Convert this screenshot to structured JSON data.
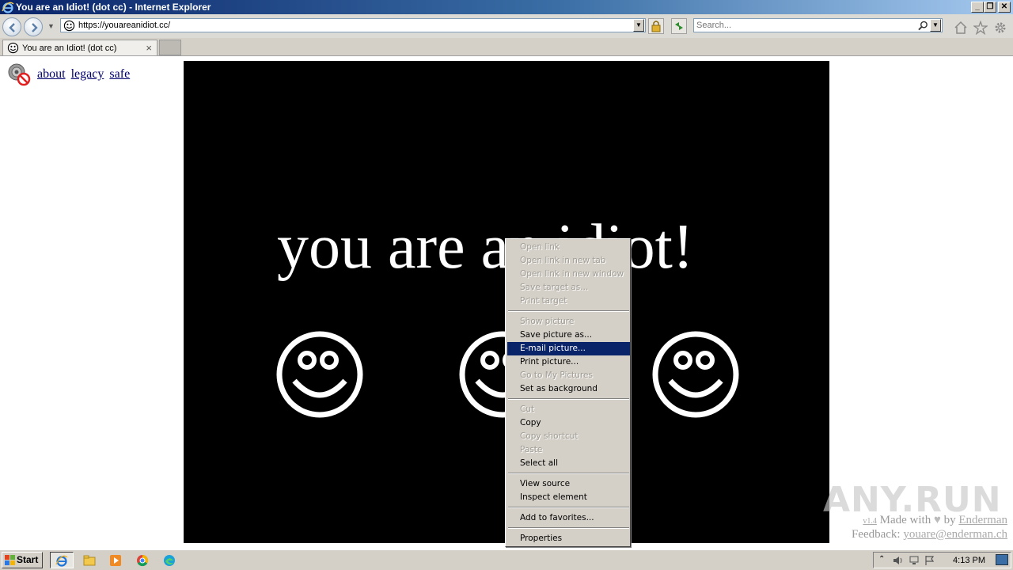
{
  "window": {
    "title": "You are an Idiot! (dot cc) - Internet Explorer",
    "minimize_glyph": "_",
    "restore_glyph": "❐",
    "close_glyph": "✕"
  },
  "navbar": {
    "url": "https://youareanidiot.cc/",
    "search_placeholder": "Search..."
  },
  "tabs": [
    {
      "label": "You are an Idiot! (dot cc)",
      "close_glyph": "×"
    }
  ],
  "page": {
    "links": [
      "about",
      "legacy",
      "safe"
    ],
    "headline": "you are an idiot!",
    "smiley_icon": "smiley-face-icon",
    "credits": {
      "version": "v1.4",
      "made_with": "Made with",
      "by": "by",
      "author": "Enderman",
      "feedback_label": "Feedback:",
      "feedback_email": "youare@enderman.ch"
    },
    "watermark": "ANY.RUN"
  },
  "context_menu": {
    "groups": [
      [
        {
          "label": "Open link",
          "enabled": false
        },
        {
          "label": "Open link in new tab",
          "enabled": false
        },
        {
          "label": "Open link in new window",
          "enabled": false
        },
        {
          "label": "Save target as...",
          "enabled": false
        },
        {
          "label": "Print target",
          "enabled": false
        }
      ],
      [
        {
          "label": "Show picture",
          "enabled": false
        },
        {
          "label": "Save picture as...",
          "enabled": true
        },
        {
          "label": "E-mail picture...",
          "enabled": true,
          "highlighted": true
        },
        {
          "label": "Print picture...",
          "enabled": true
        },
        {
          "label": "Go to My Pictures",
          "enabled": false
        },
        {
          "label": "Set as background",
          "enabled": true
        }
      ],
      [
        {
          "label": "Cut",
          "enabled": false
        },
        {
          "label": "Copy",
          "enabled": true
        },
        {
          "label": "Copy shortcut",
          "enabled": false
        },
        {
          "label": "Paste",
          "enabled": false
        },
        {
          "label": "Select all",
          "enabled": true
        }
      ],
      [
        {
          "label": "View source",
          "enabled": true
        },
        {
          "label": "Inspect element",
          "enabled": true
        }
      ],
      [
        {
          "label": "Add to favorites...",
          "enabled": true
        }
      ],
      [
        {
          "label": "Properties",
          "enabled": true
        }
      ]
    ]
  },
  "taskbar": {
    "start_label": "Start",
    "clock": "4:13 PM",
    "pinned": [
      "internet-explorer-icon",
      "explorer-folder-icon",
      "media-player-icon",
      "chrome-icon",
      "edge-icon"
    ]
  },
  "colors": {
    "menu_highlight": "#0a246a",
    "stage_background": "#000000",
    "titlebar_start": "#0a246a"
  }
}
